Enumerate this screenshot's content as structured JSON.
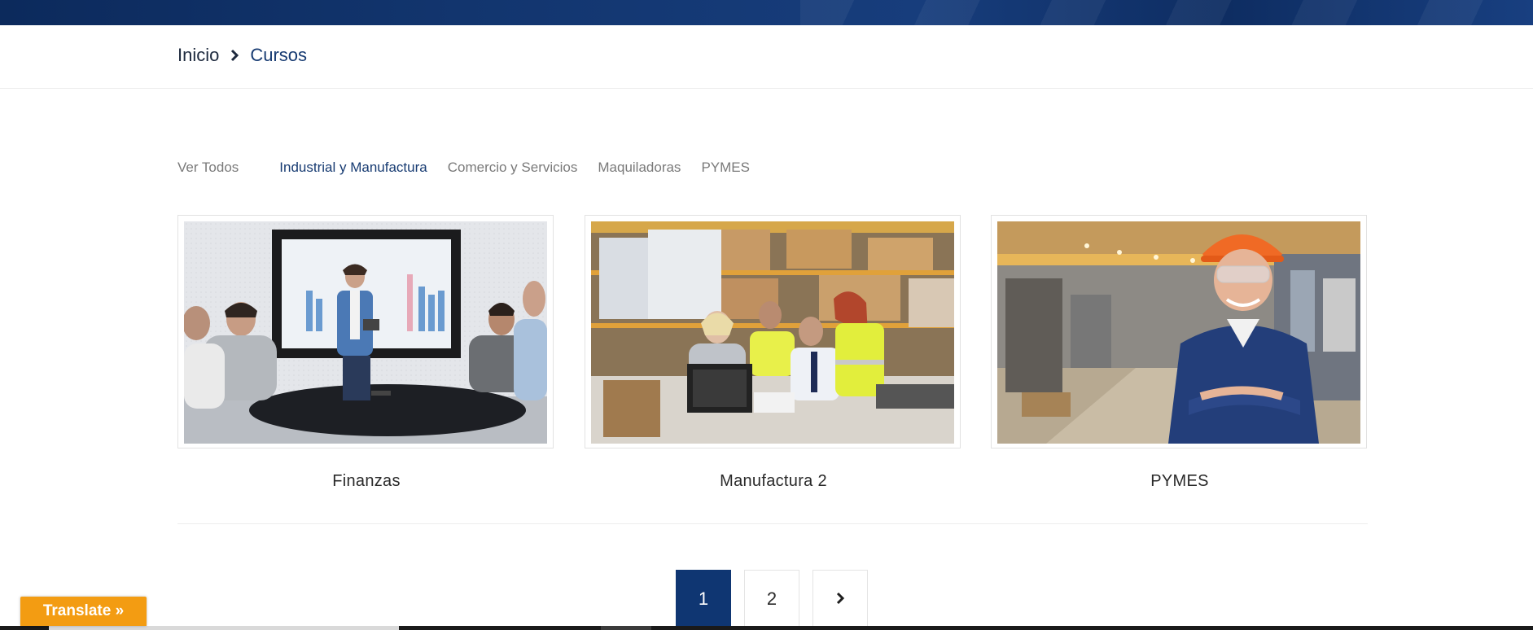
{
  "breadcrumb": {
    "home": "Inicio",
    "current": "Cursos"
  },
  "filters": [
    {
      "label": "Ver Todos",
      "active": false
    },
    {
      "label": "Industrial y Manufactura",
      "active": true
    },
    {
      "label": "Comercio y Servicios",
      "active": false
    },
    {
      "label": "Maquiladoras",
      "active": false
    },
    {
      "label": "PYMES",
      "active": false
    }
  ],
  "courses": [
    {
      "title": "Finanzas",
      "image": "business-presentation-photo"
    },
    {
      "title": "Manufactura 2",
      "image": "warehouse-team-photo"
    },
    {
      "title": "PYMES",
      "image": "factory-worker-photo"
    }
  ],
  "pagination": {
    "pages": [
      "1",
      "2"
    ],
    "current": "1",
    "next_icon": "chevron-right-icon"
  },
  "translate": {
    "label": "Translate »"
  },
  "colors": {
    "brand": "#0f3672",
    "active_filter": "#173b72",
    "translate_button": "#f39c12"
  }
}
